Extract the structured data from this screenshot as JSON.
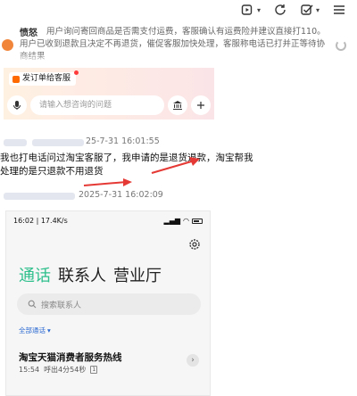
{
  "toolbar": {
    "icons": [
      "video-icon",
      "refresh-icon",
      "checkbox-icon",
      "menu-icon"
    ]
  },
  "background_chat": {
    "sender": "愤怒",
    "message": "用户询问寄回商品是否需支付运费，客服确认有运费险并建议直接打110。用户已收到退款且决定不再退货，催促客服加快处理，客服称电话已打并正等待协商结果"
  },
  "chat_panel": {
    "order_button": "发订单给客服",
    "input_placeholder": "请输入想咨询的问题"
  },
  "timestamps": {
    "first": "25-7-31 16:01:55",
    "second": "2025-7-31 16:02:09"
  },
  "caption": "我也打电话问过淘宝客服了，我申请的是退货退款，淘宝帮我处理的是只退款不用退货",
  "colors": {
    "arrow": "#e53935",
    "tab_active": "#2fbf8c",
    "filter_link": "#2d6bd2"
  },
  "phone": {
    "time": "16:02",
    "speed": "17.4K/s",
    "tabs": [
      "通话",
      "联系人",
      "营业厅"
    ],
    "search_placeholder": "搜索联系人",
    "filter_label": "全部通话",
    "call": {
      "name": "淘宝天猫消费者服务热线",
      "time": "15:54",
      "detail": "呼出4分54秒",
      "sim": "1"
    }
  }
}
